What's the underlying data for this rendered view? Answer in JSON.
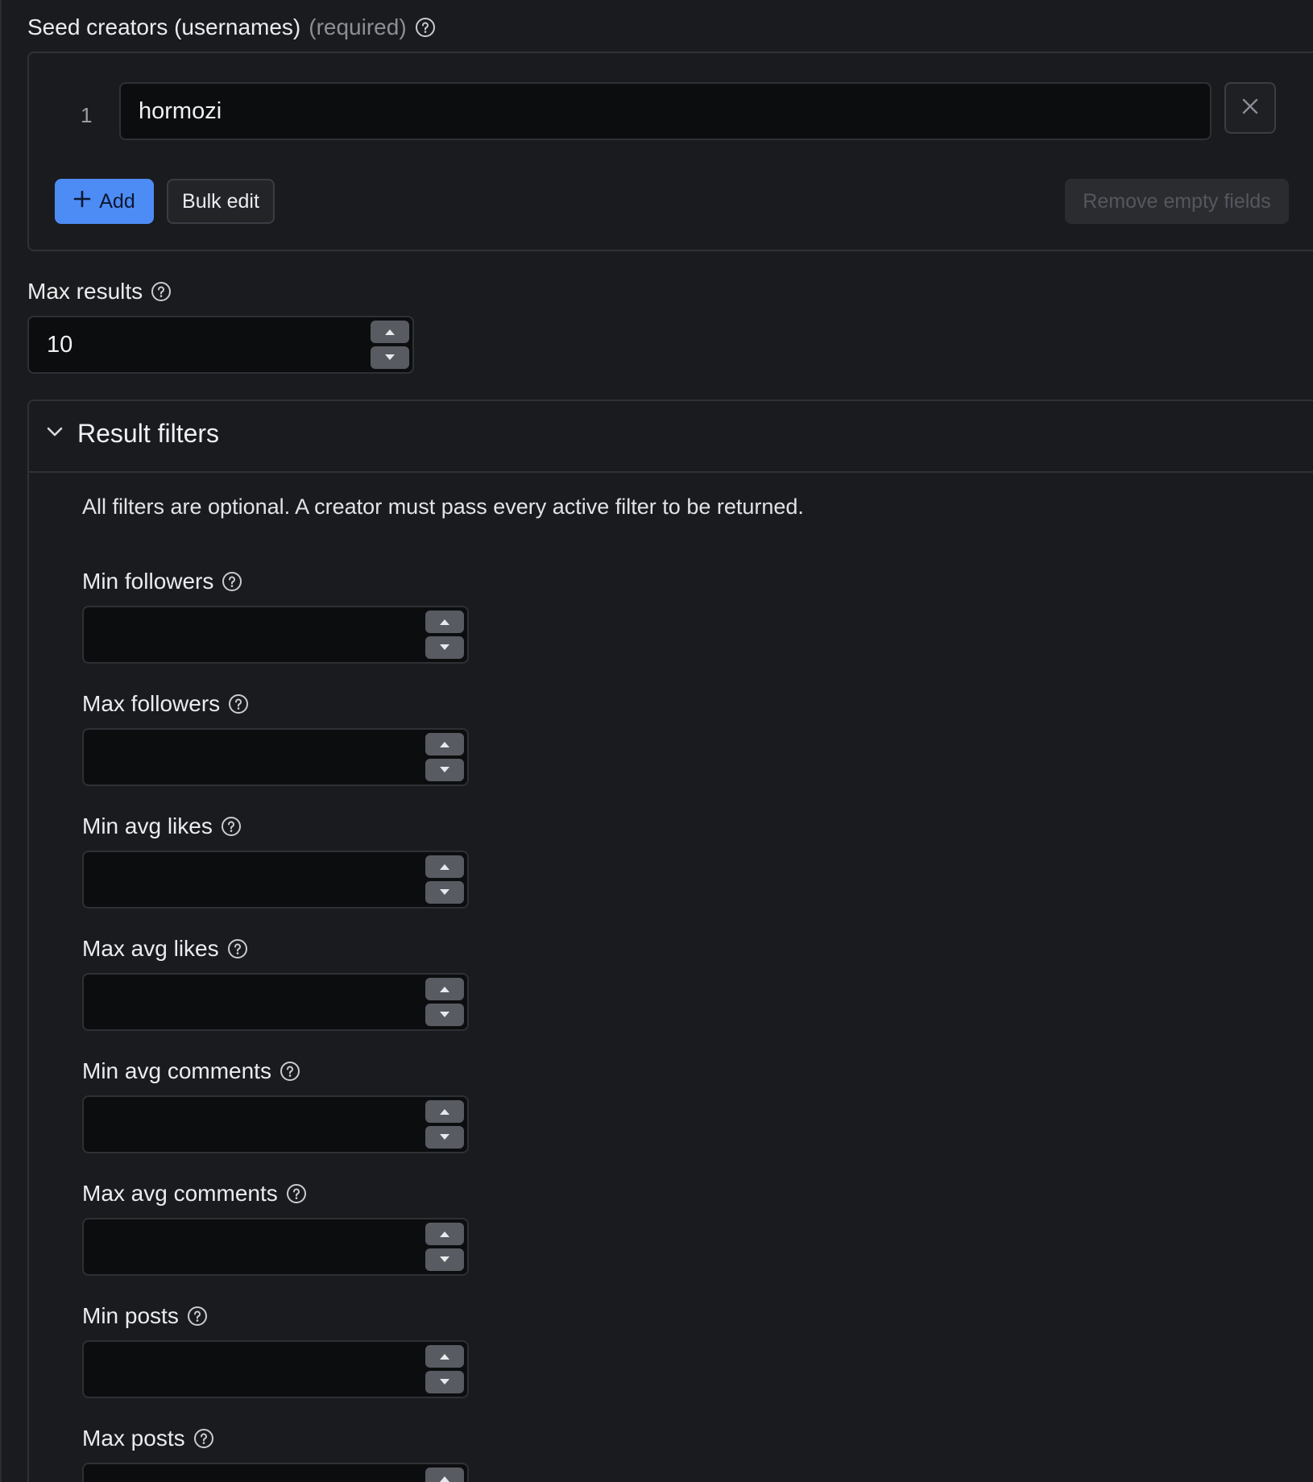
{
  "seed": {
    "label": "Seed creators (usernames)",
    "required_text": "(required)",
    "help_icon": "help-circle-icon",
    "rows": [
      {
        "index": "1",
        "value": "hormozi"
      }
    ],
    "remove_icon": "close-icon",
    "add_label": "Add",
    "add_icon": "plus-icon",
    "bulk_edit_label": "Bulk edit",
    "remove_empty_label": "Remove empty fields"
  },
  "max_results": {
    "label": "Max results",
    "value": "10"
  },
  "result_filters": {
    "title": "Result filters",
    "toggle_icon": "chevron-down-icon",
    "expanded": true,
    "description": "All filters are optional. A creator must pass every active filter to be returned.",
    "filters": [
      {
        "label": "Min followers",
        "value": ""
      },
      {
        "label": "Max followers",
        "value": ""
      },
      {
        "label": "Min avg likes",
        "value": ""
      },
      {
        "label": "Max avg likes",
        "value": ""
      },
      {
        "label": "Min avg comments",
        "value": ""
      },
      {
        "label": "Max avg comments",
        "value": ""
      },
      {
        "label": "Min posts",
        "value": ""
      },
      {
        "label": "Max posts",
        "value": ""
      }
    ]
  },
  "colors": {
    "background": "#1a1b1e",
    "input_background": "#0c0d0e",
    "accent_blue": "#4d8cf5",
    "border": "#2f3136",
    "stepper": "#585b61"
  }
}
